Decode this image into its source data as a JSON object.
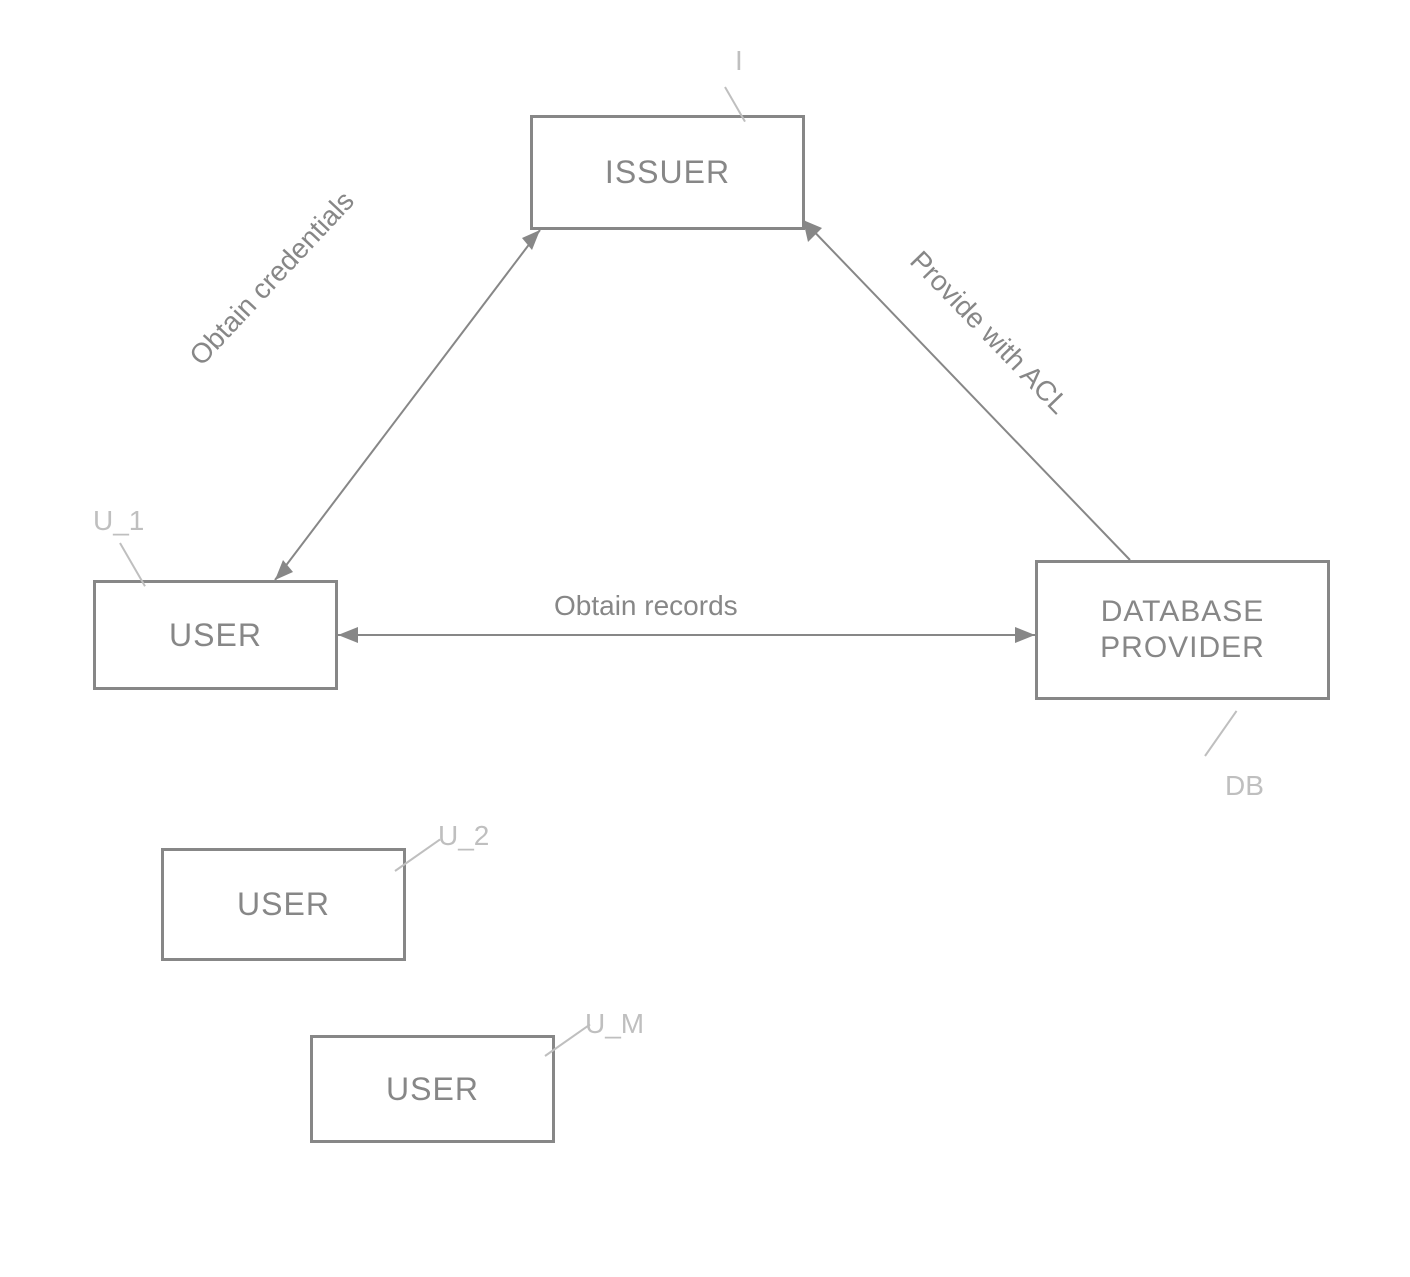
{
  "nodes": {
    "issuer": {
      "label": "ISSUER",
      "tag": "I"
    },
    "user1": {
      "label": "USER",
      "tag": "U_1"
    },
    "user2": {
      "label": "USER",
      "tag": "U_2"
    },
    "userM": {
      "label": "USER",
      "tag": "U_M"
    },
    "db": {
      "label": "DATABASE PROVIDER",
      "tag": "DB"
    }
  },
  "edges": {
    "user_issuer": {
      "label": "Obtain credentials"
    },
    "issuer_db": {
      "label": "Provide with ACL"
    },
    "user_db": {
      "label": "Obtain records"
    }
  }
}
